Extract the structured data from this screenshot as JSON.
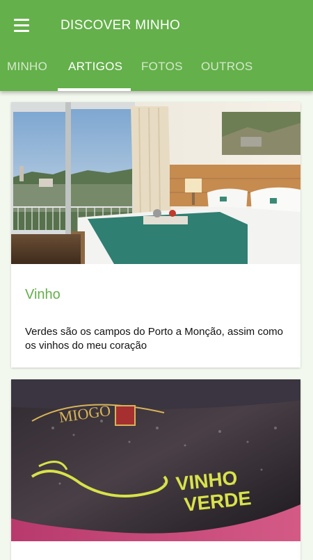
{
  "app": {
    "title": "DISCOVER MINHO"
  },
  "tabs": [
    {
      "label": "MINHO",
      "active": false
    },
    {
      "label": "ARTIGOS",
      "active": true
    },
    {
      "label": "FOTOS",
      "active": false
    },
    {
      "label": "OUTROS",
      "active": false
    }
  ],
  "colors": {
    "primary": "#64b04a",
    "background": "#f3f8ee"
  },
  "articles": [
    {
      "image": "hotel-room-photo",
      "title": "Vinho",
      "description": "Verdes são os campos do Porto a Monção, assim como os vinhos do meu coração"
    },
    {
      "image": "vinho-verde-bottle-photo",
      "logo_text": [
        "MIOGO",
        "VINHO",
        "VERDE"
      ]
    }
  ]
}
